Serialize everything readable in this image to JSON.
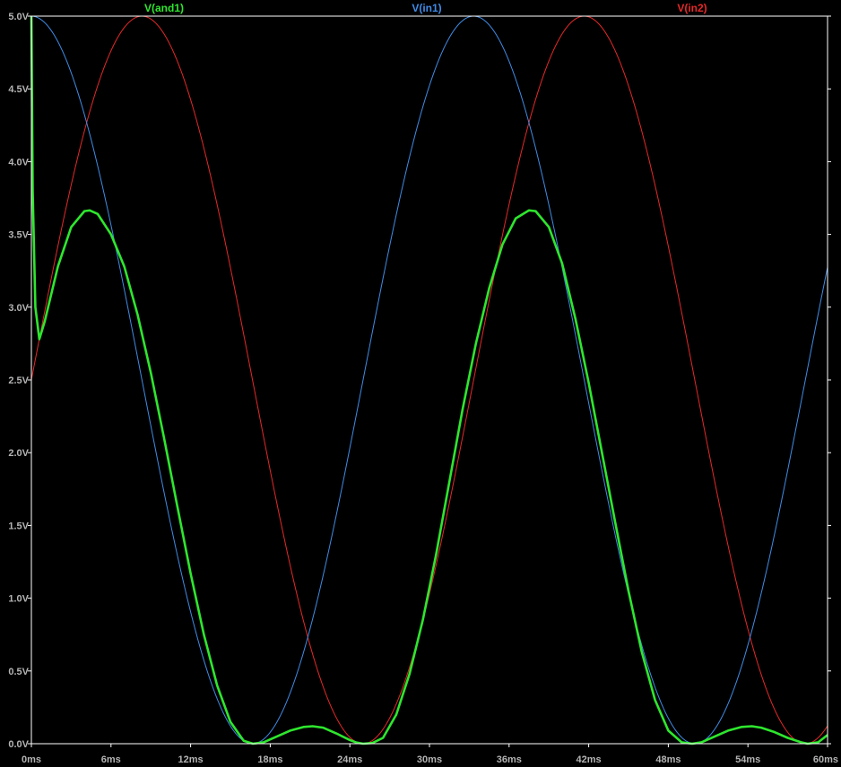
{
  "chart_data": {
    "type": "line",
    "background": "#000000",
    "frame_color": "#ffffff",
    "grid": false,
    "x_ticks": [
      "0ms",
      "6ms",
      "12ms",
      "18ms",
      "24ms",
      "30ms",
      "36ms",
      "42ms",
      "48ms",
      "54ms",
      "60ms"
    ],
    "y_ticks": [
      "0.0V",
      "0.5V",
      "1.0V",
      "1.5V",
      "2.0V",
      "2.5V",
      "3.0V",
      "3.5V",
      "4.0V",
      "4.5V",
      "5.0V"
    ],
    "xlim_ms": [
      0,
      60
    ],
    "ylim_v": [
      0,
      5
    ],
    "legend_placement": "top",
    "series": [
      {
        "name": "V(and1)",
        "color": "#2ee62e",
        "points": [
          [
            0,
            5.0
          ],
          [
            0.1,
            3.8
          ],
          [
            0.3,
            3.0
          ],
          [
            0.6,
            2.78
          ],
          [
            1.0,
            2.9
          ],
          [
            2.0,
            3.28
          ],
          [
            3.0,
            3.55
          ],
          [
            4.0,
            3.66
          ],
          [
            4.4,
            3.665
          ],
          [
            5.0,
            3.64
          ],
          [
            6.0,
            3.5
          ],
          [
            7.0,
            3.28
          ],
          [
            8.0,
            2.95
          ],
          [
            9.0,
            2.55
          ],
          [
            10.0,
            2.1
          ],
          [
            11.0,
            1.63
          ],
          [
            12.0,
            1.17
          ],
          [
            13.0,
            0.75
          ],
          [
            14.0,
            0.4
          ],
          [
            15.0,
            0.15
          ],
          [
            16.0,
            0.02
          ],
          [
            16.7,
            0.0
          ],
          [
            17.5,
            0.01
          ],
          [
            18.5,
            0.05
          ],
          [
            19.5,
            0.09
          ],
          [
            20.5,
            0.115
          ],
          [
            21.2,
            0.12
          ],
          [
            22.0,
            0.11
          ],
          [
            23.0,
            0.07
          ],
          [
            24.0,
            0.025
          ],
          [
            24.5,
            0.008
          ],
          [
            25.0,
            0.0
          ],
          [
            25.7,
            0.005
          ],
          [
            26.5,
            0.04
          ],
          [
            27.5,
            0.2
          ],
          [
            28.5,
            0.48
          ],
          [
            29.5,
            0.85
          ],
          [
            30.5,
            1.3
          ],
          [
            31.5,
            1.8
          ],
          [
            32.5,
            2.3
          ],
          [
            33.5,
            2.75
          ],
          [
            34.5,
            3.13
          ],
          [
            35.5,
            3.43
          ],
          [
            36.5,
            3.61
          ],
          [
            37.5,
            3.665
          ],
          [
            38.0,
            3.66
          ],
          [
            39.0,
            3.55
          ],
          [
            40.0,
            3.3
          ],
          [
            41.0,
            2.92
          ],
          [
            42.0,
            2.48
          ],
          [
            43.0,
            2.0
          ],
          [
            44.0,
            1.52
          ],
          [
            45.0,
            1.05
          ],
          [
            46.0,
            0.63
          ],
          [
            47.0,
            0.3
          ],
          [
            48.0,
            0.09
          ],
          [
            49.0,
            0.01
          ],
          [
            49.8,
            0.0
          ],
          [
            50.5,
            0.01
          ],
          [
            51.5,
            0.05
          ],
          [
            52.5,
            0.09
          ],
          [
            53.5,
            0.115
          ],
          [
            54.3,
            0.12
          ],
          [
            55.0,
            0.11
          ],
          [
            56.0,
            0.08
          ],
          [
            57.0,
            0.04
          ],
          [
            58.0,
            0.01
          ],
          [
            58.5,
            0.0
          ],
          [
            59.3,
            0.01
          ],
          [
            60.0,
            0.06
          ]
        ]
      },
      {
        "name": "V(in1)",
        "color": "#3f8ce6",
        "waveform": {
          "offset": 2.5,
          "amplitude": 2.5,
          "period_ms": 33.33,
          "phase_deg": 90
        }
      },
      {
        "name": "V(in2)",
        "color": "#e62828",
        "waveform": {
          "offset": 2.5,
          "amplitude": 2.5,
          "period_ms": 33.33,
          "phase_deg": 0
        }
      }
    ]
  }
}
